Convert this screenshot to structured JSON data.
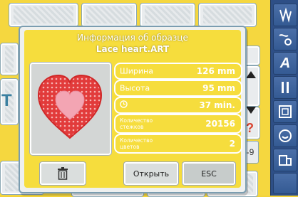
{
  "dialog": {
    "title": "Информация об образце",
    "filename": "Lace heart.ART",
    "rows": [
      {
        "label": "Ширина",
        "value": "126 mm"
      },
      {
        "label": "Высота",
        "value": "95 mm"
      },
      {
        "label": "",
        "value": "37 min."
      },
      {
        "label": "Количество стежков",
        "value": "20156"
      },
      {
        "label": "Количество цветов",
        "value": "2"
      }
    ],
    "open_label": "Открыть",
    "esc_label": "ESC"
  },
  "background": {
    "side_letter": "T",
    "right_value": "-9"
  },
  "toolbar": {
    "letter_button": "A"
  },
  "colors": {
    "accent_yellow": "#f6dd3d",
    "toolbar_blue": "#2e4f86",
    "heart_red": "#e23b3b",
    "heart_pink": "#f3a5b3"
  }
}
